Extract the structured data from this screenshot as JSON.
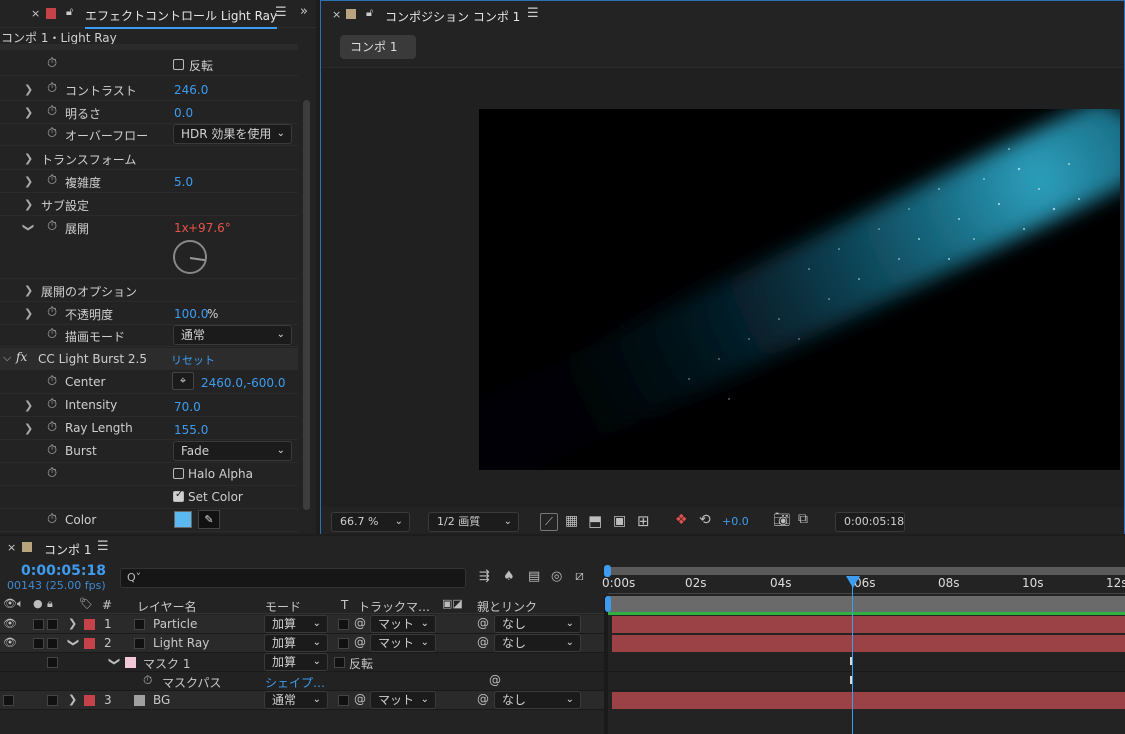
{
  "effect_panel": {
    "tab_title": "エフェクトコントロール Light Ray",
    "breadcrumb": "コンポ 1・Light Ray",
    "rows": {
      "invert_label": "反転",
      "contrast_label": "コントラスト",
      "contrast_value": "246.0",
      "brightness_label": "明るさ",
      "brightness_value": "0.0",
      "overflow_label": "オーバーフロー",
      "overflow_value": "HDR 効果を使用",
      "transform_label": "トランスフォーム",
      "complexity_label": "複雑度",
      "complexity_value": "5.0",
      "subsettings_label": "サブ設定",
      "evolution_label": "展開",
      "evolution_rev": "1x",
      "evolution_deg": "+97.6°",
      "evolution_options_label": "展開のオプション",
      "opacity_label": "不透明度",
      "opacity_value": "100.0",
      "opacity_unit": "%",
      "blend_label": "描画モード",
      "blend_value": "通常",
      "fx_badge": "fx",
      "effect_name": "CC Light Burst 2.5",
      "reset_label": "リセット",
      "center_label": "Center",
      "center_value": "2460.0,-600.0",
      "intensity_label": "Intensity",
      "intensity_value": "70.0",
      "ray_length_label": "Ray Length",
      "ray_length_value": "155.0",
      "burst_label": "Burst",
      "burst_value": "Fade",
      "halo_alpha_label": "Halo Alpha",
      "set_color_label": "Set Color",
      "color_label": "Color",
      "color_swatch": "#5bb8f0"
    }
  },
  "comp_panel": {
    "tab_title": "コンポジション コンポ 1",
    "comp_tab": "コンポ 1",
    "zoom": "66.7 %",
    "resolution": "1/2 画質",
    "exposure": "+0.0",
    "timecode": "0:00:05:18",
    "icons": [
      "alpha-grid-icon",
      "mask-toggle-icon",
      "guide-icon",
      "region-icon",
      "snapshot-icon",
      "color-channels-icon",
      "reset-exposure-icon"
    ]
  },
  "timeline": {
    "tab_title": "コンポ 1",
    "timecode": "0:00:05:18",
    "frame_info": "00143 (25.00 fps)",
    "search_placeholder": "Q˅",
    "columns": {
      "hash": "#",
      "layer_name": "レイヤー名",
      "mode": "モード",
      "t": "T",
      "track_matte": "トラックマ…",
      "parent": "親とリンク"
    },
    "ruler": [
      "0:00s",
      "02s",
      "04s",
      "06s",
      "08s",
      "10s",
      "12s"
    ],
    "layers": [
      {
        "num": "1",
        "name": "Particle",
        "mode": "加算",
        "matte": "マット",
        "parent": "なし",
        "label_color": "#c44248"
      },
      {
        "num": "2",
        "name": "Light Ray",
        "mode": "加算",
        "matte": "マット",
        "parent": "なし",
        "label_color": "#c44248"
      },
      {
        "num": "3",
        "name": "BG",
        "mode": "通常",
        "matte": "マット",
        "parent": "なし",
        "label_color": "#c44248"
      }
    ],
    "mask": {
      "name": "マスク 1",
      "mode": "加算",
      "invert": "反転",
      "path_label": "マスクパス",
      "path_value": "シェイプ…"
    },
    "accent_color": "#3e9cf0",
    "bar_color": "#9a4245"
  }
}
